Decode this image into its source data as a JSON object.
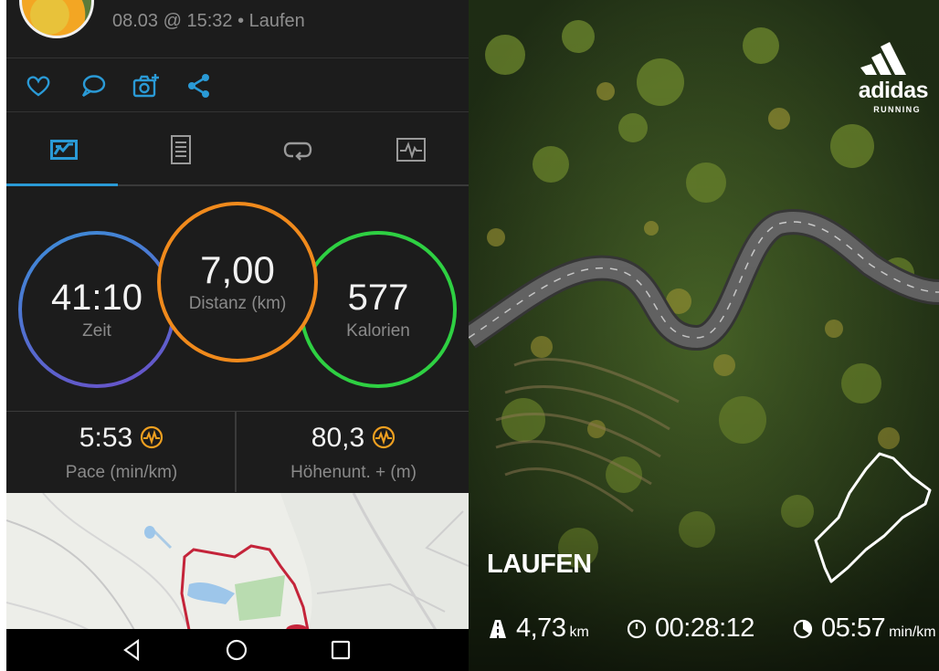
{
  "garmin": {
    "header": {
      "date_activity": "08.03 @ 15:32 • Laufen"
    },
    "action_icons": [
      "heart-icon",
      "comment-icon",
      "camera-add-icon",
      "share-icon"
    ],
    "tab_icons": [
      "overview-tab-icon",
      "details-tab-icon",
      "laps-tab-icon",
      "chart-tab-icon"
    ],
    "accent_color": "#2a9ad6",
    "rings": {
      "time": {
        "value": "41:10",
        "label": "Zeit"
      },
      "distance": {
        "value": "7,00",
        "label": "Distanz (km)"
      },
      "calories": {
        "value": "577",
        "label": "Kalorien"
      }
    },
    "metrics": {
      "pace": {
        "value": "5:53",
        "label": "Pace (min/km)"
      },
      "elevation": {
        "value": "80,3",
        "label": "Höhenunt. + (m)"
      }
    },
    "nav_icons": [
      "back-icon",
      "home-icon",
      "recents-icon"
    ]
  },
  "adidas": {
    "brand": {
      "name": "adidas",
      "sub": "RUNNING"
    },
    "activity": "LAUFEN",
    "stats": {
      "distance": {
        "value": "4,73",
        "unit": "km"
      },
      "duration": {
        "value": "00:28:12",
        "unit": ""
      },
      "pace": {
        "value": "05:57",
        "unit": "min/km"
      }
    }
  }
}
